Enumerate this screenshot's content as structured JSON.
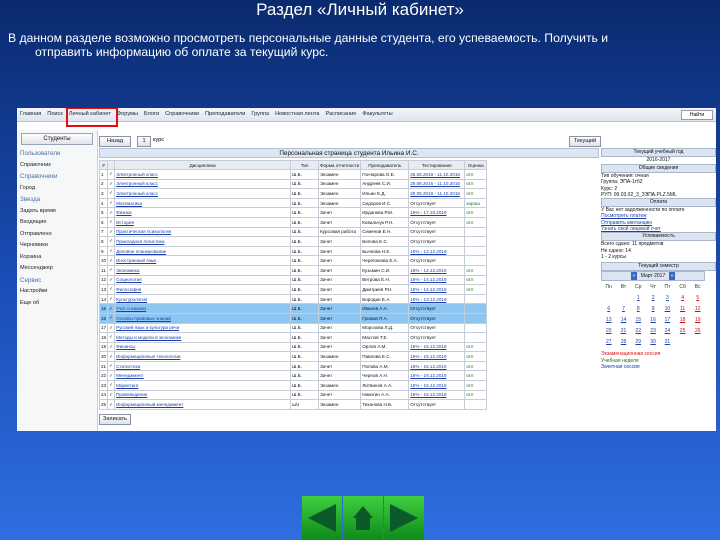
{
  "slide": {
    "title": "Раздел «Личный кабинет»",
    "text_line1": "В данном разделе возможно просмотреть персональные данные  студента, его успеваемость. Получить и",
    "text_line2": "отправить информацию  об оплате за текущий курс."
  },
  "app": {
    "menu": [
      "Главная",
      "Поиск",
      "Личный кабинет",
      "Форумы",
      "Блоги",
      "Справочники",
      "Преподаватели",
      "Группа",
      "Новостная лента",
      "Расписание",
      "Факультеты"
    ],
    "search_label": "Найти",
    "sidebar": {
      "tab": "Студенты",
      "items": [
        {
          "label": "Пользователи",
          "header": true
        },
        {
          "label": "Справочник",
          "header": false
        },
        {
          "label": "Справочники",
          "header": true
        },
        {
          "label": "Город",
          "header": false
        },
        {
          "label": "Звезда",
          "header": true
        },
        {
          "label": "Задать время",
          "header": false
        },
        {
          "label": "Входящие",
          "header": false
        },
        {
          "label": "Отправлено",
          "header": false
        },
        {
          "label": "Черновики",
          "header": false
        },
        {
          "label": "Корзина",
          "header": false
        },
        {
          "label": "Мессенджер",
          "header": false
        },
        {
          "label": "Сервис",
          "header": true
        },
        {
          "label": "Настройки",
          "header": false
        },
        {
          "label": "Еще об",
          "header": false
        }
      ]
    },
    "toolbar": {
      "back_label": "Назад",
      "page": "1",
      "course_label": "курс",
      "current_label": "Текущий"
    },
    "page_title": "Персональная страница студента Ильина И.С.",
    "table": {
      "headers": [
        "#",
        "",
        "Дисциплина",
        "Тип",
        "Форма отчетности",
        "Преподаватель",
        "Тестирование",
        "Оценка"
      ],
      "rows": [
        [
          "1",
          "✓",
          "Электронный класс",
          "Ш.Б.",
          "Экзамен",
          "Гончарова О.Е.",
          "26.08.2016 - 11.10.2016",
          "отл"
        ],
        [
          "2",
          "✓",
          "Электронный класс",
          "Ш.Б.",
          "Экзамен",
          "Андреев С.И.",
          "28.08.2016 - 11.10.2016",
          "отл"
        ],
        [
          "3",
          "✓",
          "Электронный класс",
          "Ш.Б.",
          "Экзамен",
          "Ильин Е.Д.",
          "28.08.2016 - 11.10.2016",
          "отл"
        ],
        [
          "4",
          "✓",
          "Математика",
          "Ш.Б.",
          "Экзамен",
          "Сидоров И.С.",
          "Отсутствует",
          "хорош"
        ],
        [
          "5",
          "✓",
          "Физика",
          "Ш.Б.",
          "Зачет",
          "Ирданова Р.М.",
          "16% - 17.10.2016",
          "отл"
        ],
        [
          "6",
          "✓",
          "История",
          "Ш.Б.",
          "Зачет",
          "Ковальчук Р.Н.",
          "Отсутствует",
          "отл"
        ],
        [
          "7",
          "✓",
          "Практическая психология",
          "Ш.Б.",
          "Курсовая работа",
          "Семенов Е.Н.",
          "Отсутствует",
          ""
        ],
        [
          "8",
          "✓",
          "Прикладная логистика",
          "Ш.Б.",
          "Зачет",
          "Белова Е.С.",
          "Отсутствует",
          ""
        ],
        [
          "9",
          "✓",
          "Деловое планирование",
          "Ш.Б.",
          "Зачет",
          "Бычкова Н.К.",
          "16% - 12.12.2016",
          ""
        ],
        [
          "10",
          "✓",
          "Иностранный язык",
          "Ш.Б.",
          "Зачет",
          "Черепанова Е.А.",
          "Отсутствует",
          ""
        ],
        [
          "11",
          "✓",
          "Экономика",
          "Ш.Б.",
          "Зачет",
          "Кузьмин С.И.",
          "16% - 14.12.2016",
          "отл"
        ],
        [
          "12",
          "✓",
          "Социология",
          "Ш.Б.",
          "Зачет",
          "Ветрова Е.Н.",
          "16% - 14.12.2016",
          "отл"
        ],
        [
          "13",
          "✓",
          "Философия",
          "Ш.Б.",
          "Зачет",
          "Дмитриев Р.Н.",
          "16% - 14.12.2016",
          "отл"
        ],
        [
          "14",
          "✓",
          "Культурология",
          "Ш.Б.",
          "Зачет",
          "Бородин Е.А.",
          "16% - 13.12.2016",
          ""
        ],
        [
          "15",
          "✓",
          "Учет и анализ",
          "Ш.Б.",
          "Зачет",
          "Иванов А.А.",
          "Отсутствует",
          ""
        ],
        [
          "16",
          "✓",
          "Основы правовых знаний",
          "Ш.Б.",
          "Зачет",
          "Громов П.А.",
          "Отсутствует",
          ""
        ],
        [
          "17",
          "✓",
          "Русский язык и культура речи",
          "Ш.Б.",
          "Зачет",
          "Морозова Л.Д.",
          "Отсутствует",
          ""
        ],
        [
          "18",
          "✓",
          "Методы и модели в экономике",
          "Ш.Б.",
          "Зачет",
          "Маслов Т.Е.",
          "Отсутствует",
          ""
        ],
        [
          "19",
          "✓",
          "Финансы",
          "Ш.Б.",
          "Зачет",
          "Орлов А.М.",
          "16% - 15.12.2016",
          "отл"
        ],
        [
          "20",
          "✓",
          "Информационные технологии",
          "Ш.Б.",
          "Экзамен",
          "Павлова Е.С.",
          "16% - 15.12.2016",
          "отл"
        ],
        [
          "21",
          "✓",
          "Статистика",
          "Ш.Б.",
          "Зачет",
          "Попова А.М.",
          "16% - 16.12.2016",
          "отл"
        ],
        [
          "22",
          "✓",
          "Менеджмент",
          "Ш.Б.",
          "Зачет",
          "Чернов А.Н.",
          "16% - 16.12.2016",
          "отл"
        ],
        [
          "23",
          "✓",
          "Маркетинг",
          "Ш.Б.",
          "Экзамен",
          "Литвинов А.А.",
          "16% - 16.12.2016",
          "отл"
        ],
        [
          "24",
          "✓",
          "Правоведение",
          "Ш.Б.",
          "Зачет",
          "Никитин А.А.",
          "16% - 16.12.2016",
          "отл"
        ],
        [
          "25",
          "✓",
          "Информационный менеджмент",
          "ш/з",
          "Экзамен",
          "Тихонова Н.Б.",
          "Отсутствует",
          ""
        ]
      ],
      "highlight_rows": [
        14,
        15
      ]
    },
    "save_label": "Записать",
    "right": {
      "year_header": "Текущий учебный год",
      "year": "2016-2017",
      "info_header": "Общие сведения",
      "info_lines": [
        "Тип обучения: очная",
        "Группа: ЭПА-1тб2",
        "Курс: 2",
        "РУП: 09.03.02_3_ЗЭПА.PLZ.5ML"
      ],
      "payment_header": "Оплата",
      "payment_lines": [
        "У Вас нет задолженности по оплате",
        "Посмотреть платеж",
        "Отправить квитанцию",
        "Узнать свой лицевой счет"
      ],
      "progress_header": "Успеваемость",
      "progress_lines": [
        "Всего сдано: 11 предметов",
        "Не сдано: 14",
        "1 - 2 курсы"
      ],
      "calendar_header": "Текущий семестр",
      "calendar_month": "Март 2017",
      "calendar_prev": "«",
      "calendar_next": "»",
      "weekdays": [
        "Пн",
        "Вт",
        "Ср",
        "Чт",
        "Пт",
        "Сб",
        "Вс"
      ],
      "weeks": [
        [
          "",
          "",
          "1",
          "2",
          "3",
          "4",
          "5"
        ],
        [
          "6",
          "7",
          "8",
          "9",
          "10",
          "11",
          "12"
        ],
        [
          "13",
          "14",
          "15",
          "16",
          "17",
          "18",
          "19"
        ],
        [
          "20",
          "21",
          "22",
          "23",
          "24",
          "25",
          "26"
        ],
        [
          "27",
          "28",
          "29",
          "30",
          "31",
          "",
          ""
        ]
      ],
      "legend": [
        "Экзаменационная сессия",
        "Учебная неделя",
        "Зачетная сессия"
      ],
      "legend_colors": [
        "#d01010",
        "#107a10",
        "#1030c0"
      ]
    }
  }
}
